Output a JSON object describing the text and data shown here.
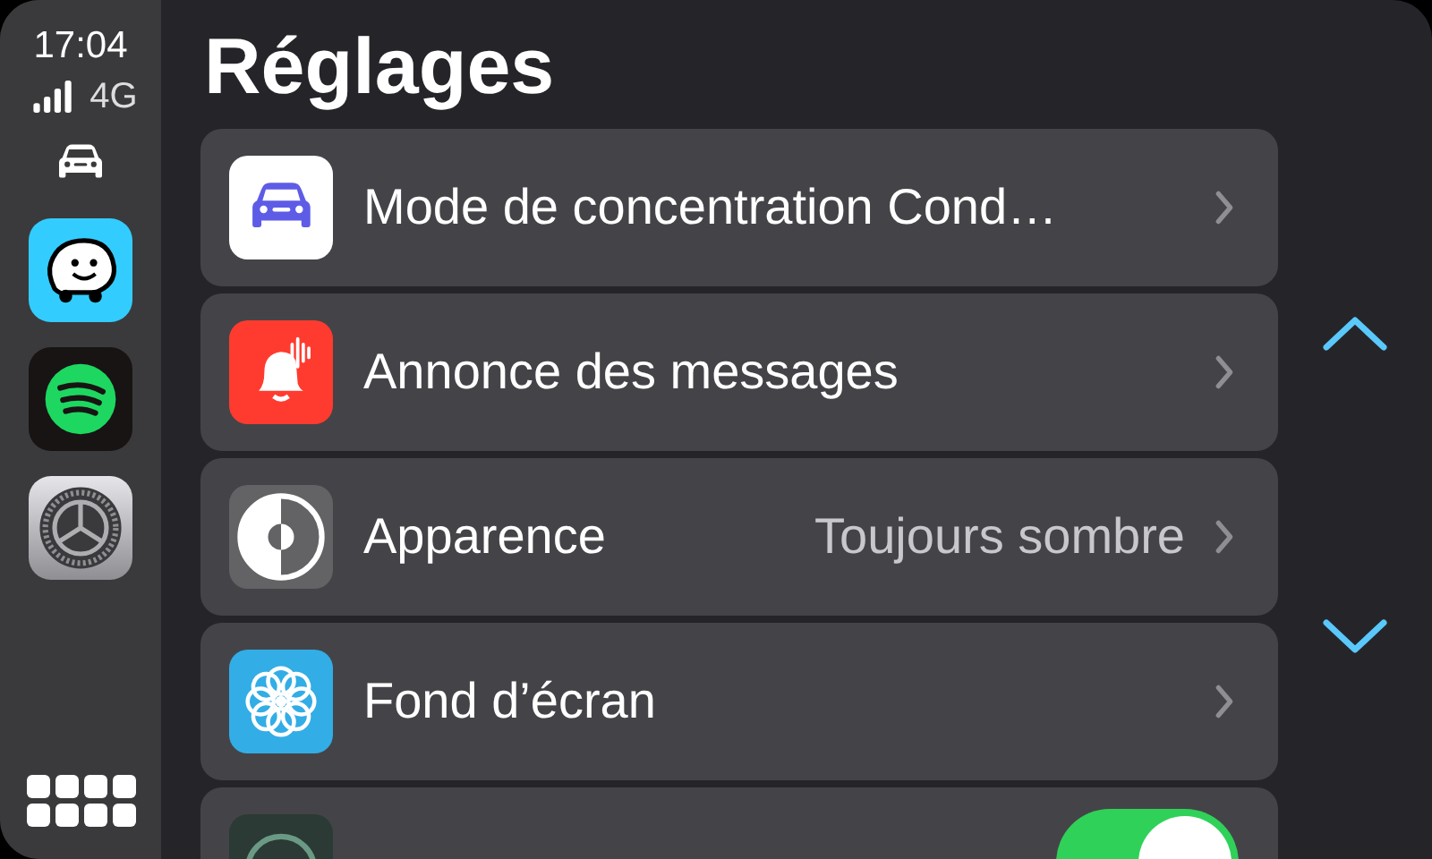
{
  "status": {
    "time": "17:04",
    "network": "4G"
  },
  "title": "Réglages",
  "rows": [
    {
      "kind": "link",
      "label": "Mode de concentration Cond…"
    },
    {
      "kind": "link",
      "label": "Annonce des messages"
    },
    {
      "kind": "link",
      "label": "Apparence",
      "value": "Toujours sombre"
    },
    {
      "kind": "link",
      "label": "Fond d’écran"
    },
    {
      "kind": "toggle",
      "on": true
    }
  ]
}
